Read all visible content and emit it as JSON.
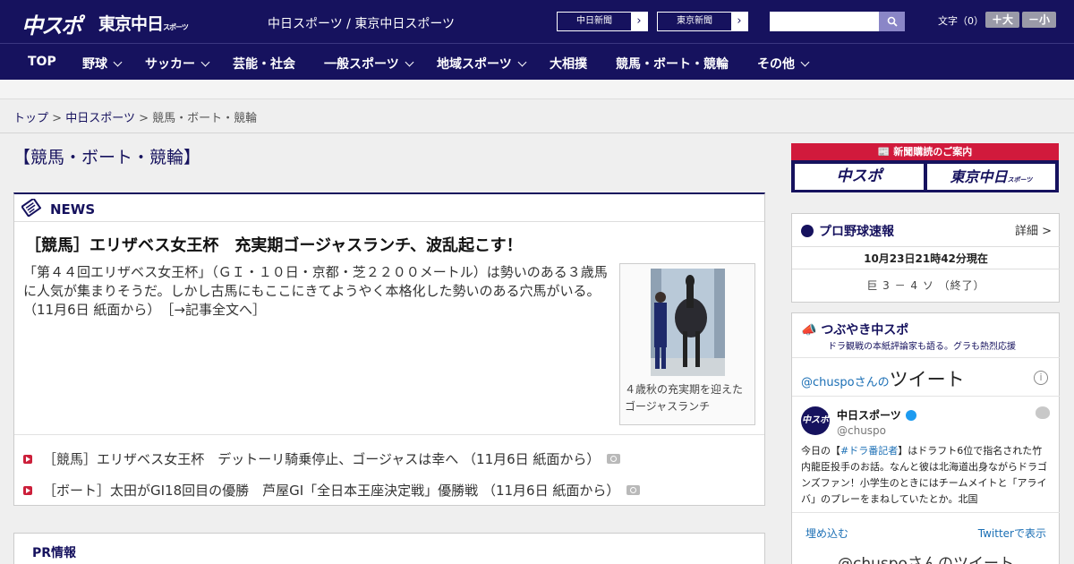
{
  "header": {
    "logo_chuspo": "中スポ",
    "logo_tokyo": "東京中日",
    "logo_tokyo_sub": "スポーツ",
    "site_name": "中日スポーツ / 東京中日スポーツ",
    "paper_links": [
      "中日新聞",
      "東京新聞"
    ],
    "search_placeholder": "",
    "font_size_label": "文字（0）",
    "font_bigger": "＋大",
    "font_smaller": "－小"
  },
  "nav": {
    "items": [
      {
        "label": "TOP",
        "dropdown": false
      },
      {
        "label": "野球",
        "dropdown": true
      },
      {
        "label": "サッカー",
        "dropdown": true
      },
      {
        "label": "芸能・社会",
        "dropdown": false
      },
      {
        "label": "一般スポーツ",
        "dropdown": true
      },
      {
        "label": "地域スポーツ",
        "dropdown": true
      },
      {
        "label": "大相撲",
        "dropdown": false
      },
      {
        "label": "競馬・ボート・競輪",
        "dropdown": false
      },
      {
        "label": "その他",
        "dropdown": true
      }
    ]
  },
  "breadcrumb": {
    "home": "トップ",
    "sep": ">",
    "section": "中日スポーツ",
    "current": "競馬・ボート・競輪"
  },
  "page_title": "【競馬・ボート・競輪】",
  "news": {
    "header": "NEWS",
    "headline": "［競馬］エリザベス女王杯　充実期ゴージャスランチ、波乱起こす！",
    "body": "「第４４回エリザベス女王杯」（ＧＩ・１０日・京都・芝２２００メートル）は勢いのある３歳馬に人気が集まりそうだ。しかし古馬にもここにきてようやく本格化した勢いのある穴馬がいる。（11月6日 紙面から）　［→記事全文へ］",
    "photo_caption": "４歳秋の充実期を迎えたゴージャスランチ",
    "links": [
      {
        "text": "［競馬］エリザベス女王杯　デットーリ騎乗停止、ゴージャスは幸へ （11月6日 紙面から）",
        "photo": true
      },
      {
        "text": "［ボート］太田がGI18回目の優勝　芦屋GI「全日本王座決定戦」優勝戦 （11月6日 紙面から）",
        "photo": true
      }
    ]
  },
  "pr": {
    "title": "PR情報"
  },
  "sidebar": {
    "subscription": {
      "title": "新聞購読のご案内",
      "logos": [
        "中スポ",
        "東京中日"
      ],
      "logo_sub": "スポーツ"
    },
    "baseball": {
      "title": "プロ野球速報",
      "detail": "詳細 >",
      "time": "10月23日21時42分現在",
      "score": "巨 3 － 4 ソ （終了）"
    },
    "tweets": {
      "title": "つぶやき中スポ",
      "subtitle": "ドラ観戦の本紙評論家も語る。グラも熱烈応援",
      "timeline_prefix": "@chuspoさんの",
      "timeline_label": "ツイート",
      "account_name": "中日スポーツ",
      "account_handle": "@chuspo",
      "avatar_text": "中スポ",
      "tweet_prefix": "今日の【",
      "tweet_tag": "#ドラ番記者",
      "tweet_text": "】はドラフト6位で指名された竹内龍臣投手のお話。なんと彼は北海道出身ながらドラゴンズファン！小学生のときにはチームメイトと「アライバ」のプレーをまねしていたとか。北国",
      "embed": "埋め込む",
      "view_on": "Twitterで表示",
      "footer": "@chuspoさんのツイート"
    }
  }
}
